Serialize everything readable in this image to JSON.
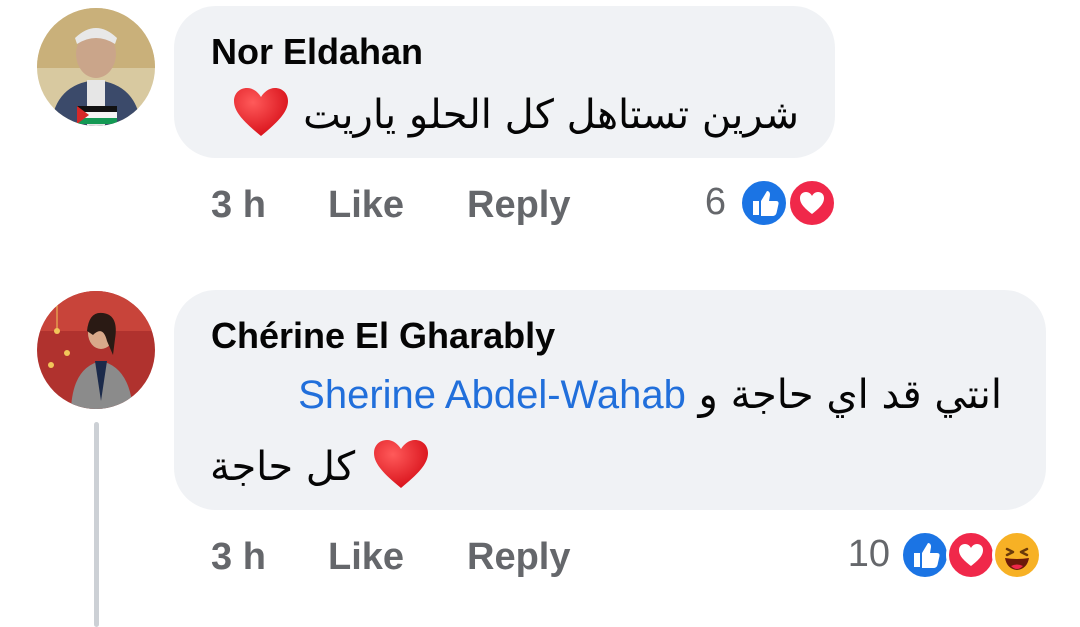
{
  "colors": {
    "like_blue": "#1b74e4",
    "love_red": "#f0284a",
    "haha_yellow": "#f7b125",
    "mention_blue": "#216fdb",
    "meta_gray": "#65676b",
    "bubble_bg": "#f0f2f5"
  },
  "comments": [
    {
      "author": "Nor Eldahan",
      "text": "شرين تستاهل كل الحلو ياريت",
      "emoji": "heart-icon",
      "time": "3 h",
      "like_label": "Like",
      "reply_label": "Reply",
      "reaction_count": "6",
      "reactions": [
        "like-reaction-icon",
        "love-reaction-icon"
      ]
    },
    {
      "author": "Chérine El Gharably",
      "text_line1_rtl": "انتي قد اي حاجة و",
      "mention": "Sherine Abdel-Wahab",
      "text_line2": "كل حاجة",
      "emoji": "heart-icon",
      "time": "3 h",
      "like_label": "Like",
      "reply_label": "Reply",
      "reaction_count": "10",
      "reactions": [
        "like-reaction-icon",
        "love-reaction-icon",
        "haha-reaction-icon"
      ]
    }
  ]
}
